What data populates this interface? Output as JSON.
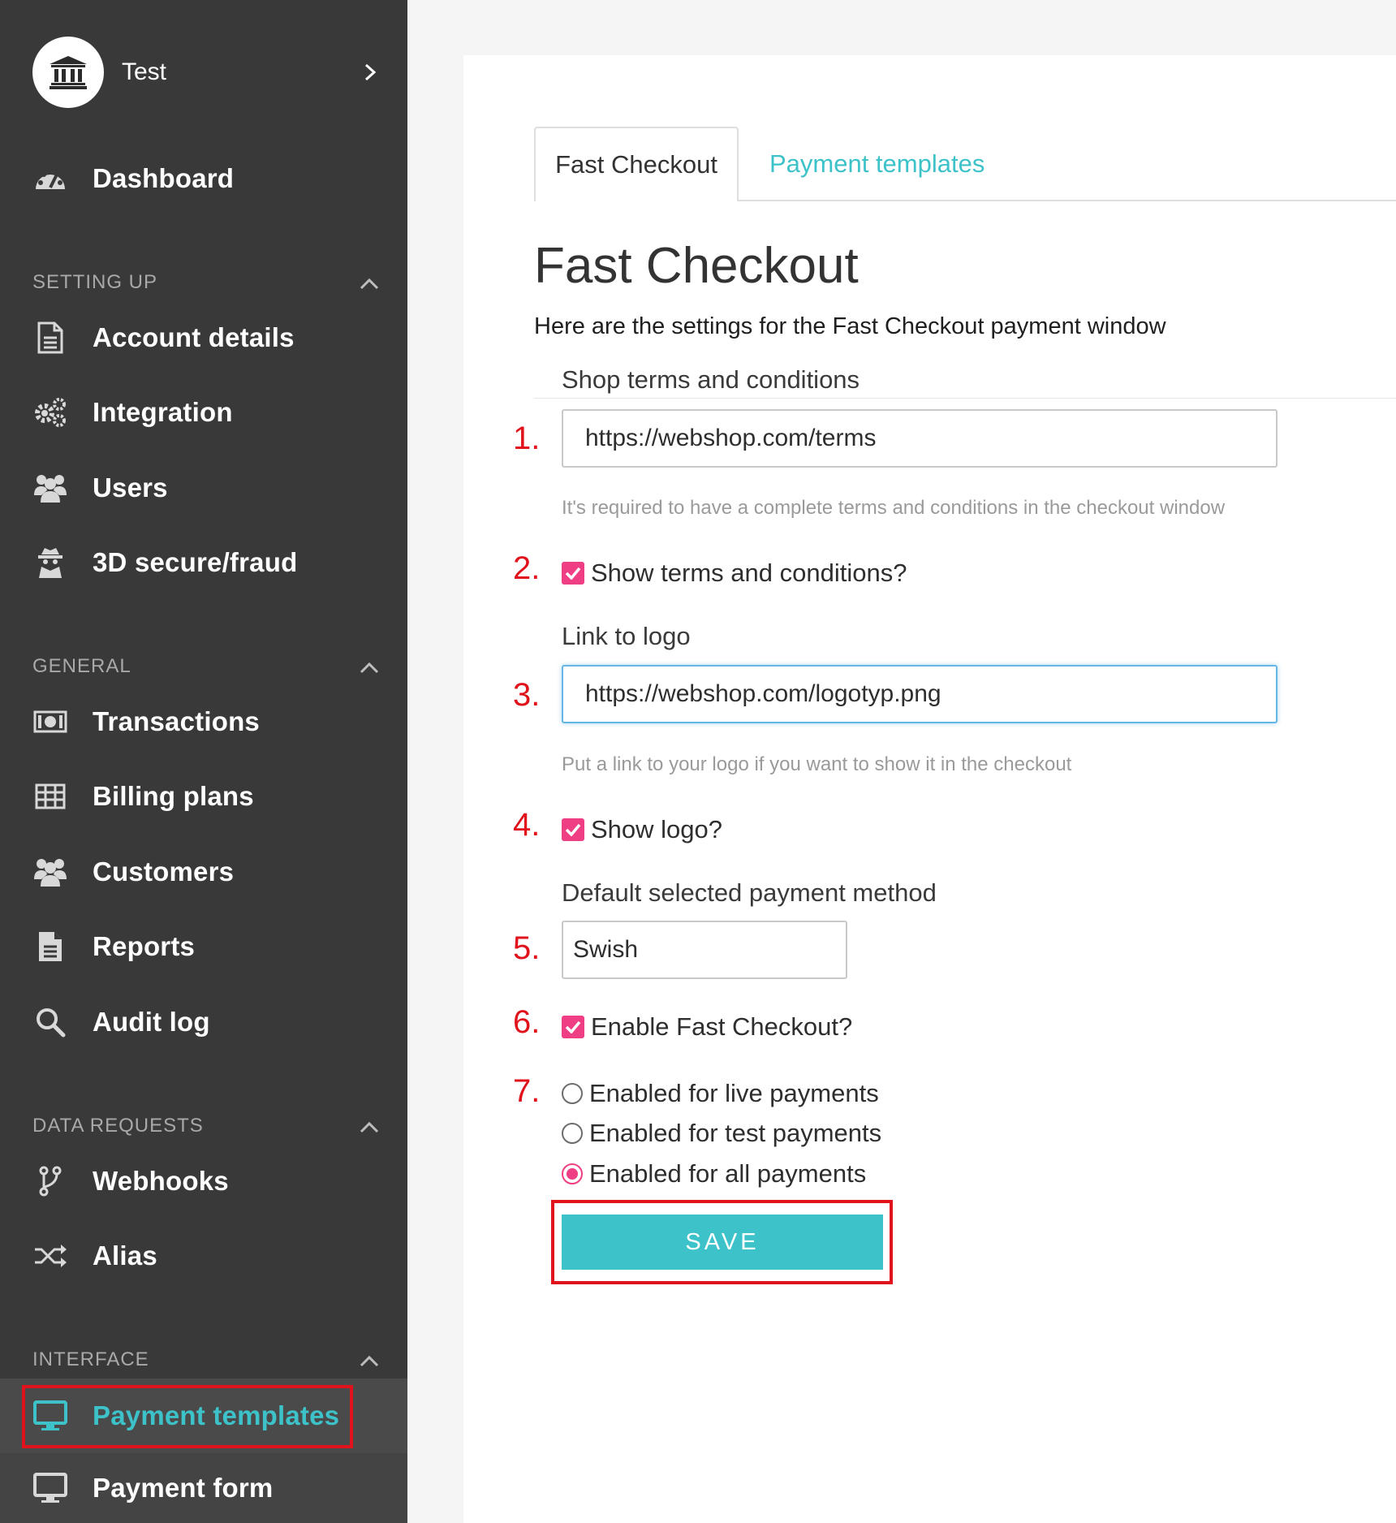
{
  "account": {
    "name": "Test",
    "icon": "bank-icon"
  },
  "sidebar": {
    "dashboard": {
      "label": "Dashboard",
      "icon": "dashboard-gauge-icon"
    },
    "sections": [
      {
        "title": "SETTING UP",
        "items": [
          {
            "label": "Account details",
            "icon": "document-icon"
          },
          {
            "label": "Integration",
            "icon": "gears-icon"
          },
          {
            "label": "Users",
            "icon": "users-icon"
          },
          {
            "label": "3D secure/fraud",
            "icon": "spy-icon"
          }
        ]
      },
      {
        "title": "GENERAL",
        "items": [
          {
            "label": "Transactions",
            "icon": "money-bill-icon"
          },
          {
            "label": "Billing plans",
            "icon": "table-grid-icon"
          },
          {
            "label": "Customers",
            "icon": "users-icon"
          },
          {
            "label": "Reports",
            "icon": "file-text-icon"
          },
          {
            "label": "Audit log",
            "icon": "search-icon"
          }
        ]
      },
      {
        "title": "DATA REQUESTS",
        "items": [
          {
            "label": "Webhooks",
            "icon": "branch-icon"
          },
          {
            "label": "Alias",
            "icon": "shuffle-icon"
          }
        ]
      },
      {
        "title": "INTERFACE",
        "items": [
          {
            "label": "Payment templates",
            "icon": "monitor-icon",
            "active": true
          },
          {
            "label": "Payment form",
            "icon": "monitor-icon"
          }
        ]
      }
    ]
  },
  "tabs": [
    {
      "label": "Fast Checkout",
      "active": true
    },
    {
      "label": "Payment templates",
      "active": false
    }
  ],
  "page": {
    "title": "Fast Checkout",
    "subtitle": "Here are the settings for the Fast Checkout payment window"
  },
  "form": {
    "terms_label": "Shop terms and conditions",
    "terms_value": "https://webshop.com/terms",
    "terms_hint": "It's required to have a complete terms and conditions in the checkout window",
    "show_terms_label": "Show terms and conditions?",
    "logo_label": "Link to logo",
    "logo_value": "https://webshop.com/logotyp.png",
    "logo_hint": "Put a link to your logo if you want to show it in the checkout",
    "show_logo_label": "Show logo?",
    "default_method_label": "Default selected payment method",
    "default_method_value": "Swish",
    "enable_label": "Enable Fast Checkout?",
    "radios": [
      {
        "label": "Enabled for live payments",
        "selected": false
      },
      {
        "label": "Enabled for test payments",
        "selected": false
      },
      {
        "label": "Enabled for all payments",
        "selected": true
      }
    ],
    "save_label": "SAVE"
  },
  "annotations": [
    "1.",
    "2.",
    "3.",
    "4.",
    "5.",
    "6.",
    "7."
  ],
  "colors": {
    "accent": "#3cc2c8",
    "checkbox": "#ef3e84",
    "highlight": "#e0121b",
    "sidebar": "#393939"
  }
}
